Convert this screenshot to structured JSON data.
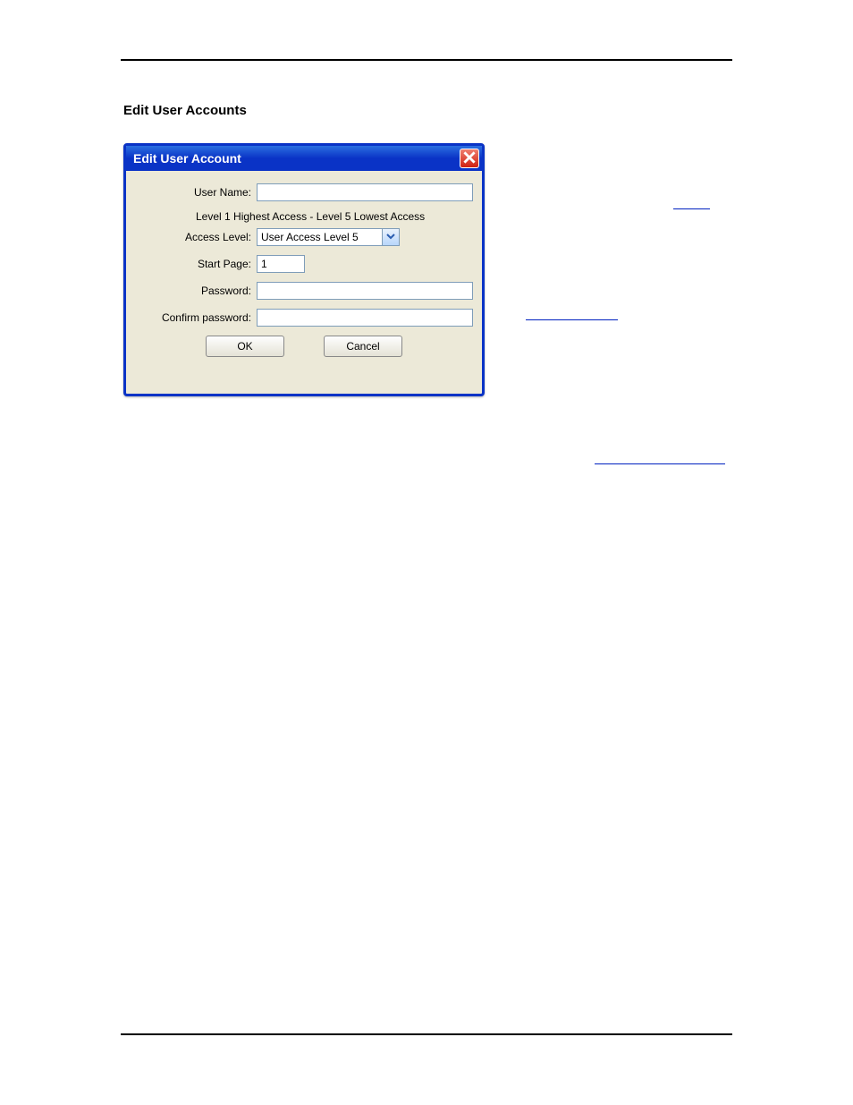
{
  "page": {
    "heading": "Edit User Accounts"
  },
  "dialog": {
    "title": "Edit User Account",
    "help_line": "Level 1 Highest Access - Level 5 Lowest Access",
    "labels": {
      "user_name": "User Name:",
      "access_level": "Access Level:",
      "start_page": "Start Page:",
      "password": "Password:",
      "confirm_password": "Confirm password:"
    },
    "values": {
      "user_name": "",
      "access_level": "User Access Level 5",
      "start_page": "1",
      "password": "",
      "confirm_password": ""
    },
    "buttons": {
      "ok": "OK",
      "cancel": "Cancel"
    }
  }
}
